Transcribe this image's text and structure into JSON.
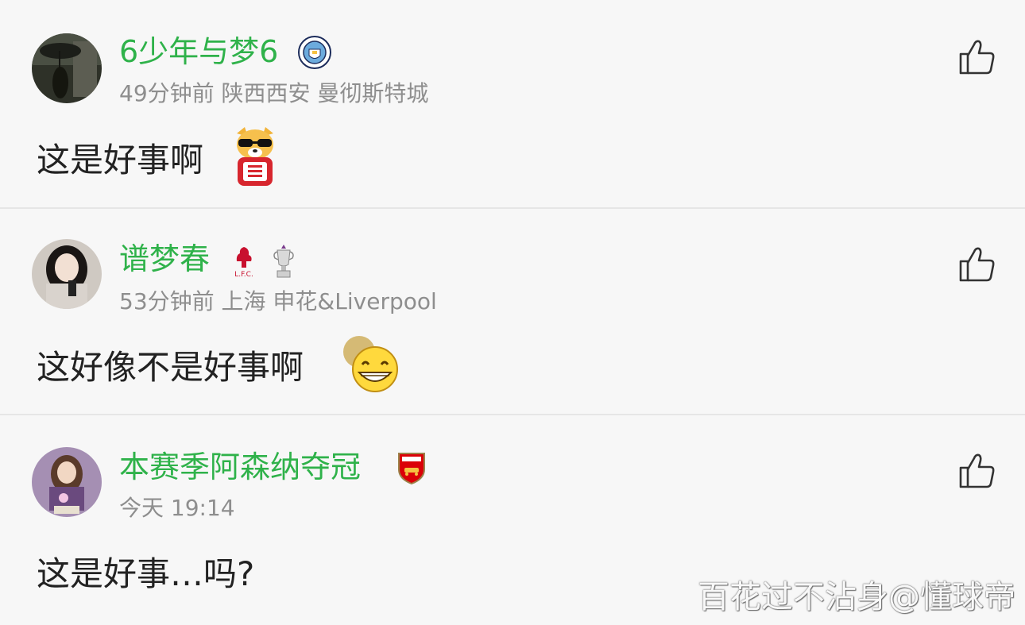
{
  "comments": [
    {
      "username": "6少年与梦6",
      "meta": "49分钟前 陕西西安 曼彻斯特城",
      "body": "这是好事啊",
      "badges": [
        "manchester-city-crest-icon"
      ],
      "emoji": "dog-sunglasses-sticker"
    },
    {
      "username": "谱梦春",
      "meta": "53分钟前 上海 申花&Liverpool",
      "body": "这好像不是好事啊",
      "badges": [
        "liverpool-crest-icon",
        "premier-league-trophy-icon"
      ],
      "emoji": "grin-face-emoji"
    },
    {
      "username": "本赛季阿森纳夺冠",
      "meta": "今天 19:14",
      "body": "这是好事…吗?",
      "badges": [
        "arsenal-crest-icon"
      ],
      "emoji": ""
    }
  ],
  "colors": {
    "username": "#2fb24a",
    "meta": "#8e8e8e",
    "body": "#222222",
    "background": "#f7f7f7"
  },
  "watermark": "百花过不沾身@懂球帝"
}
